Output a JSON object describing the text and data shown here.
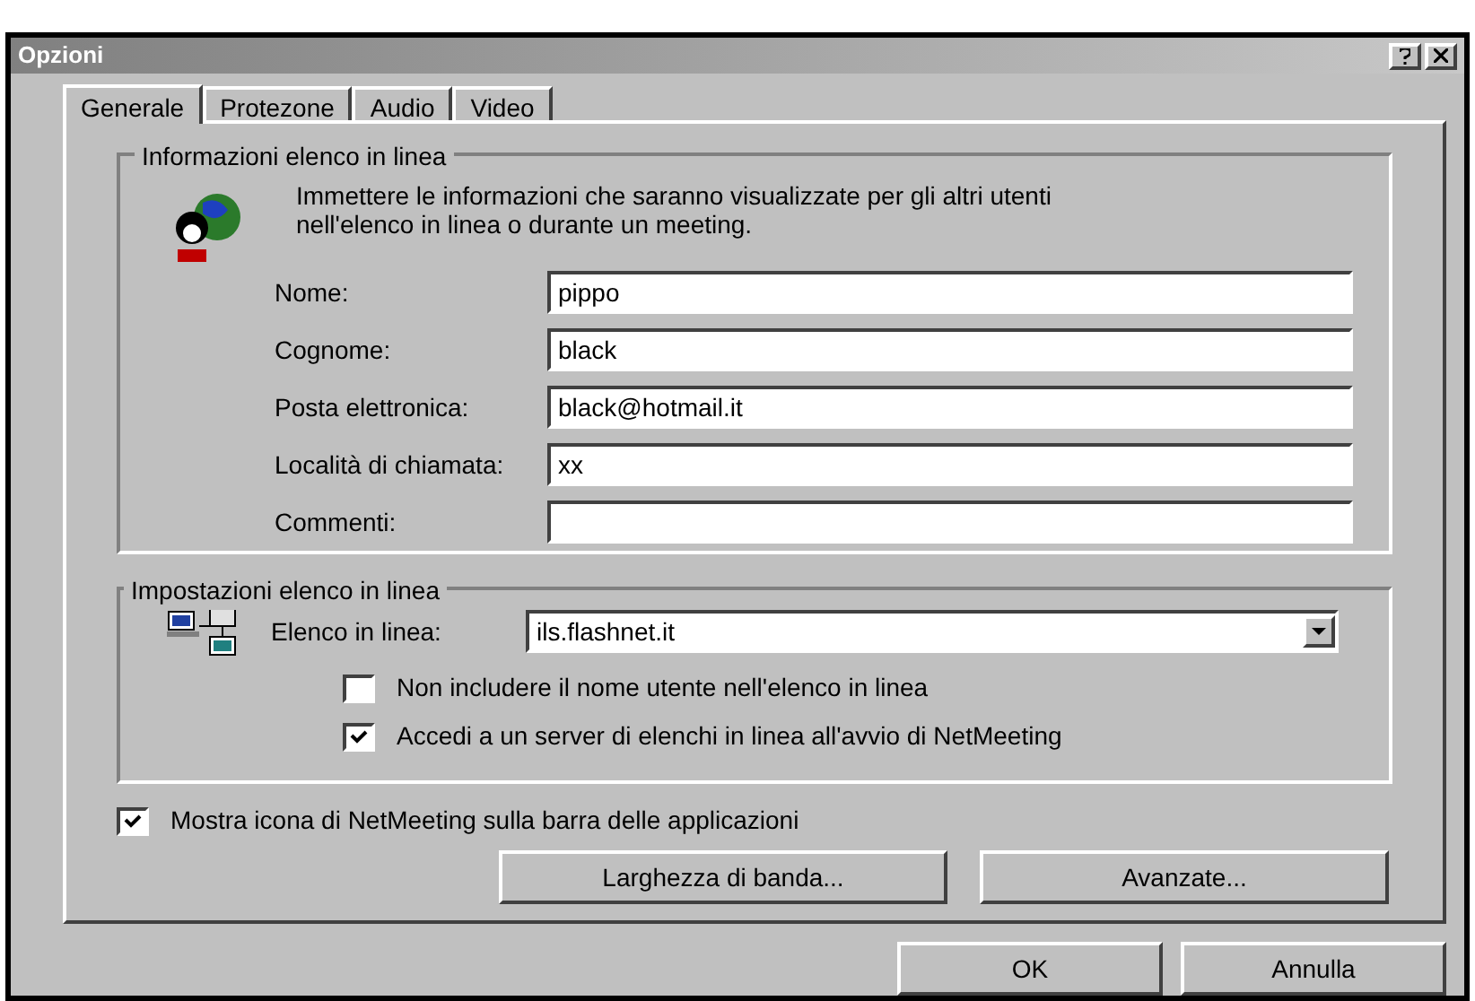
{
  "window": {
    "title": "Opzioni"
  },
  "tabs": [
    {
      "label": "Generale",
      "selected": true
    },
    {
      "label": "Protezone",
      "selected": false
    },
    {
      "label": "Audio",
      "selected": false
    },
    {
      "label": "Video",
      "selected": false
    }
  ],
  "info_group": {
    "title": "Informazioni elenco in linea",
    "description": "Immettere le informazioni che saranno visualizzate per gli altri utenti nell'elenco in linea o durante un meeting.",
    "fields": [
      {
        "label": "Nome:",
        "value": "pippo"
      },
      {
        "label": "Cognome:",
        "value": "black"
      },
      {
        "label": "Posta elettronica:",
        "value": "black@hotmail.it"
      },
      {
        "label": "Località di chiamata:",
        "value": "xx"
      },
      {
        "label": "Commenti:"
      }
    ]
  },
  "directory_group": {
    "title": "Impostazioni elenco in linea",
    "dropdown": {
      "label": "Elenco in linea:",
      "value": "ils.flashnet.it"
    },
    "checkboxes": [
      {
        "label": "Non includere il nome utente nell'elenco in linea",
        "checked": false
      },
      {
        "label": "Accedi a un server di elenchi in linea all'avvio di NetMeeting",
        "checked": true
      }
    ]
  },
  "taskbar_checkbox": {
    "label": "Mostra icona di NetMeeting sulla barra delle applicazioni",
    "checked": true
  },
  "option_buttons": [
    "Larghezza di banda...",
    "Avanzate..."
  ],
  "buttons": [
    "OK",
    "Annulla"
  ]
}
